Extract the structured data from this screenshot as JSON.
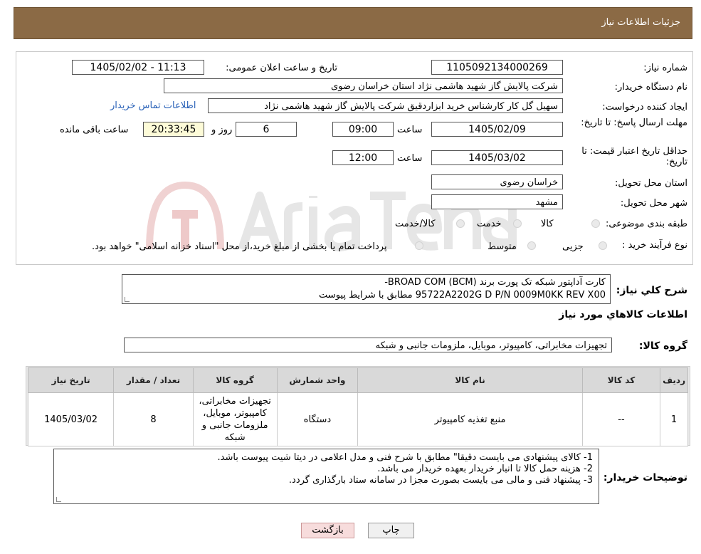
{
  "header": {
    "title": "جزئیات اطلاعات نیاز"
  },
  "form": {
    "need_number_label": "شماره نیاز:",
    "need_number": "1105092134000269",
    "announce_label": "تاریخ و ساعت اعلان عمومی:",
    "announce_value": "1405/02/02 - 11:13",
    "buyer_org_label": "نام دستگاه خریدار:",
    "buyer_org": "شرکت پالایش گاز شهید هاشمی نژاد   استان خراسان رضوی",
    "requester_label": "ایجاد کننده درخواست:",
    "requester": "سهیل گل کار کارشناس خرید ابزاردقیق شرکت پالایش گاز شهید هاشمی نژاد",
    "contact_link": "اطلاعات تماس خریدار",
    "deadline_label": "مهلت ارسال پاسخ: تا تاریخ:",
    "deadline_date": "1405/02/09",
    "time_label": "ساعت",
    "deadline_time": "09:00",
    "days_value": "6",
    "days_label": "روز و",
    "remaining_time": "20:33:45",
    "remaining_label": "ساعت باقی مانده",
    "validity_label": "حداقل تاریخ اعتبار قیمت: تا تاریخ:",
    "validity_date": "1405/03/02",
    "validity_time": "12:00",
    "province_label": "استان محل تحویل:",
    "province": "خراسان رضوی",
    "city_label": "شهر محل تحویل:",
    "city": "مشهد",
    "category_label": "طبقه بندی موضوعی:",
    "category_options": [
      "کالا",
      "خدمت",
      "کالا/خدمت"
    ],
    "process_label": "نوع فرآیند خرید :",
    "process_options": [
      "جزیی",
      "متوسط"
    ],
    "process_note": "پرداخت تمام یا بخشی از مبلغ خرید،از محل \"اسناد خزانه اسلامی\" خواهد بود."
  },
  "description": {
    "label": "شرح کلي نياز:",
    "line1": "کارت آداپتور شبکه تک پورت برند BROAD COM (BCM)-",
    "line2": "95722A2202G D P/N 0009M0KK REV X00 مطابق با شرایط پیوست"
  },
  "goods": {
    "section_title": "اطلاعات کالاهاي مورد نياز",
    "group_label": "گروه کالا:",
    "group_value": "تجهیزات مخابراتی، کامپیوتر، موبایل، ملزومات جانبی و شبکه"
  },
  "table": {
    "headers": [
      "رديف",
      "کد کالا",
      "نام کالا",
      "واحد شمارش",
      "گروه کالا",
      "تعداد / مقدار",
      "تاریخ نیاز"
    ],
    "rows": [
      [
        "1",
        "--",
        "منبع تغذیه کامپیوتر",
        "دستگاه",
        "تجهیزات مخابراتی، کامپیوتر، موبایل، ملزومات جانبی و شبکه",
        "8",
        "1405/03/02"
      ]
    ]
  },
  "buyer_notes": {
    "label": "توضیحات خریدار:",
    "lines": [
      "1-     کالای پیشنهادی می بایست دقیقا\" مطابق با شرح فنی و مدل اعلامی در دیتا شیت پیوست باشد.",
      "2-     هزینه حمل کالا تا انبار خریدار بعهده خریدار می باشد.",
      "3-     پیشنهاد فنی و مالی می بایست بصورت مجزا در سامانه ستاد بارگذاری گردد."
    ]
  },
  "buttons": {
    "print": "چاپ",
    "back": "بازگشت"
  }
}
